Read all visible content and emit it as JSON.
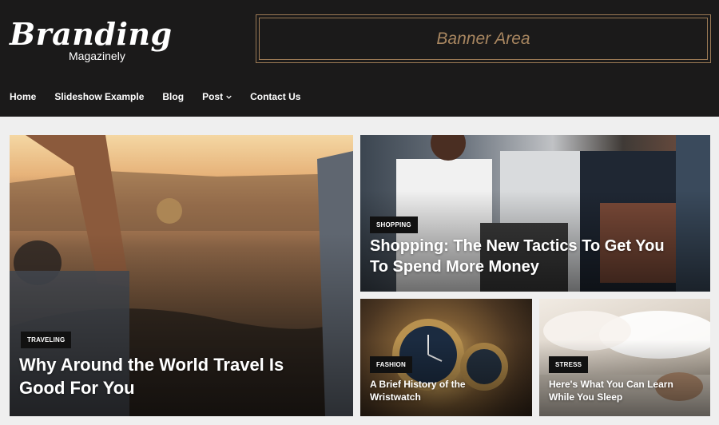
{
  "brand": {
    "name": "Branding",
    "tagline": "Magazinely"
  },
  "banner": {
    "label": "Banner Area"
  },
  "nav": {
    "home": "Home",
    "slideshow": "Slideshow Example",
    "blog": "Blog",
    "post": "Post",
    "contact": "Contact Us"
  },
  "cards": [
    {
      "category": "TRAVELING",
      "title_line1": "Why Around the World Travel Is",
      "title_line2": "Good For You"
    },
    {
      "category": "SHOPPING",
      "title_line1": "Shopping: The New Tactics To Get You",
      "title_line2": "To Spend More Money"
    },
    {
      "category": "FASHION",
      "title_line1": "A Brief History of the",
      "title_line2": "Wristwatch"
    },
    {
      "category": "STRESS",
      "title_line1": "Here's What You Can Learn",
      "title_line2": "While You Sleep"
    }
  ],
  "colors": {
    "header_bg": "#1b1a1a",
    "banner_gold": "#9c7a55",
    "page_bg": "#efefef"
  },
  "icons": {
    "post_dropdown": "chevron-down-icon"
  }
}
